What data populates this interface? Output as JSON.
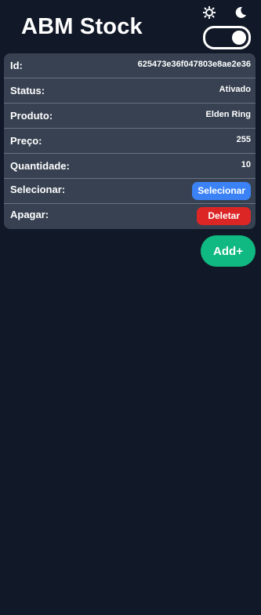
{
  "header": {
    "title": "ABM Stock",
    "light_icon": "sun-icon",
    "dark_icon": "moon-icon",
    "theme_toggle": "dark-mode-toggle"
  },
  "item": {
    "rows": [
      {
        "label": "Id:",
        "value": "625473e36f047803e8ae2e36"
      },
      {
        "label": "Status:",
        "value": "Ativado"
      },
      {
        "label": "Produto:",
        "value": "Elden Ring"
      },
      {
        "label": "Preço:",
        "value": "255"
      },
      {
        "label": "Quantidade:",
        "value": "10"
      }
    ],
    "select_label": "Selecionar:",
    "select_button": "Selecionar",
    "delete_label": "Apagar:",
    "delete_button": "Deletar"
  },
  "actions": {
    "add_button": "Add+"
  },
  "colors": {
    "background": "#111827",
    "card": "#374151",
    "select": "#3b82f6",
    "delete": "#dc2626",
    "add": "#10b981"
  }
}
